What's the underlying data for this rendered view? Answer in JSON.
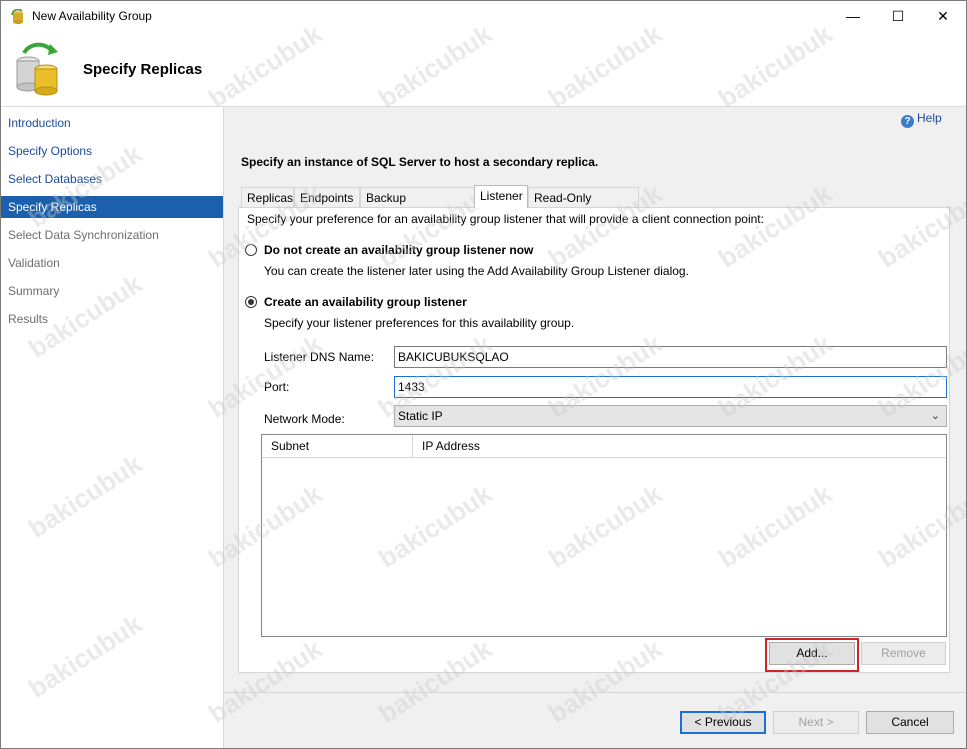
{
  "window": {
    "title": "New Availability Group",
    "controls": {
      "minimize": "—",
      "maximize": "☐",
      "close": "✕"
    }
  },
  "header": {
    "title": "Specify Replicas"
  },
  "nav": {
    "items": [
      {
        "label": "Introduction",
        "state": "link"
      },
      {
        "label": "Specify Options",
        "state": "link"
      },
      {
        "label": "Select Databases",
        "state": "link"
      },
      {
        "label": "Specify Replicas",
        "state": "active"
      },
      {
        "label": "Select Data Synchronization",
        "state": "disabled"
      },
      {
        "label": "Validation",
        "state": "disabled"
      },
      {
        "label": "Summary",
        "state": "disabled"
      },
      {
        "label": "Results",
        "state": "disabled"
      }
    ]
  },
  "help": {
    "label": "Help",
    "icon": "?"
  },
  "main": {
    "instruction": "Specify an instance of SQL Server to host a secondary replica.",
    "tabs": [
      {
        "label": "Replicas",
        "active": false
      },
      {
        "label": "Endpoints",
        "active": false
      },
      {
        "label": "Backup Preferences",
        "active": false
      },
      {
        "label": "Listener",
        "active": true
      },
      {
        "label": "Read-Only Routing",
        "active": false
      }
    ],
    "listener": {
      "description": "Specify your preference for an availability group listener that will provide a client connection point:",
      "option_no": {
        "label": "Do not create an availability group listener now",
        "hint": "You can create the listener later using the Add Availability Group Listener dialog.",
        "checked": false
      },
      "option_yes": {
        "label": "Create an availability group listener",
        "hint": "Specify your listener preferences for this availability group.",
        "checked": true
      },
      "dns_label": "Listener DNS Name:",
      "dns_value": "BAKICUBUKSQLAO",
      "port_label": "Port:",
      "port_value": "1433",
      "mode_label": "Network Mode:",
      "mode_value": "Static IP",
      "grid_columns": [
        "Subnet",
        "IP Address"
      ],
      "add_button": "Add...",
      "remove_button": "Remove"
    }
  },
  "footer": {
    "previous": "< Previous",
    "next": "Next >",
    "cancel": "Cancel"
  },
  "watermark": "bakicubuk",
  "colors": {
    "accent": "#1c5fad",
    "link": "#1a4c9c",
    "highlight": "#d0242a"
  }
}
